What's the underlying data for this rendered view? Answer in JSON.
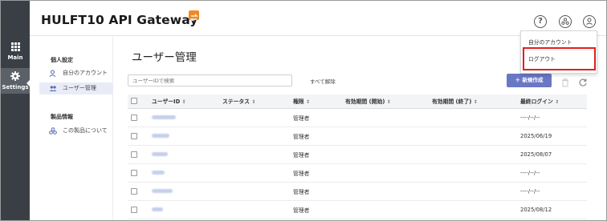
{
  "rail": {
    "items": [
      {
        "label": "Main",
        "icon": "grid-icon"
      },
      {
        "label": "Settings",
        "icon": "gear-icon"
      }
    ]
  },
  "header": {
    "brand": "HULFT10 API Gateway",
    "brand_badge_color": "#f08a24",
    "help_glyph": "?"
  },
  "sidebar": {
    "sections": [
      {
        "heading": "個人設定",
        "items": [
          {
            "label": "自分のアカウント",
            "icon": "user-icon",
            "active": false
          },
          {
            "label": "ユーザー管理",
            "icon": "users-icon",
            "active": true
          }
        ]
      },
      {
        "heading": "製品情報",
        "items": [
          {
            "label": "この製品について",
            "icon": "product-icon",
            "active": false
          }
        ]
      }
    ]
  },
  "main": {
    "title": "ユーザー管理",
    "search_placeholder": "ユーザーIDで検索",
    "clear_all": "すべて解除",
    "new_button": "＋ 新規作成",
    "columns": [
      "ユーザーID",
      "ステータス",
      "権限",
      "有効期間 (開始)",
      "有効期間 (終了)",
      "最終ログイン"
    ],
    "rows": [
      {
        "role": "管理者",
        "last_login": "----/--/--"
      },
      {
        "role": "管理者",
        "last_login": "2025/06/19"
      },
      {
        "role": "管理者",
        "last_login": "2025/08/07"
      },
      {
        "role": "管理者",
        "last_login": "----/--/--"
      },
      {
        "role": "管理者",
        "last_login": "----/--/--"
      },
      {
        "role": "管理者",
        "last_login": "2025/08/12"
      }
    ]
  },
  "user_menu": {
    "items": [
      "自分のアカウント",
      "ログアウト"
    ],
    "highlight_color": "#e02020"
  }
}
